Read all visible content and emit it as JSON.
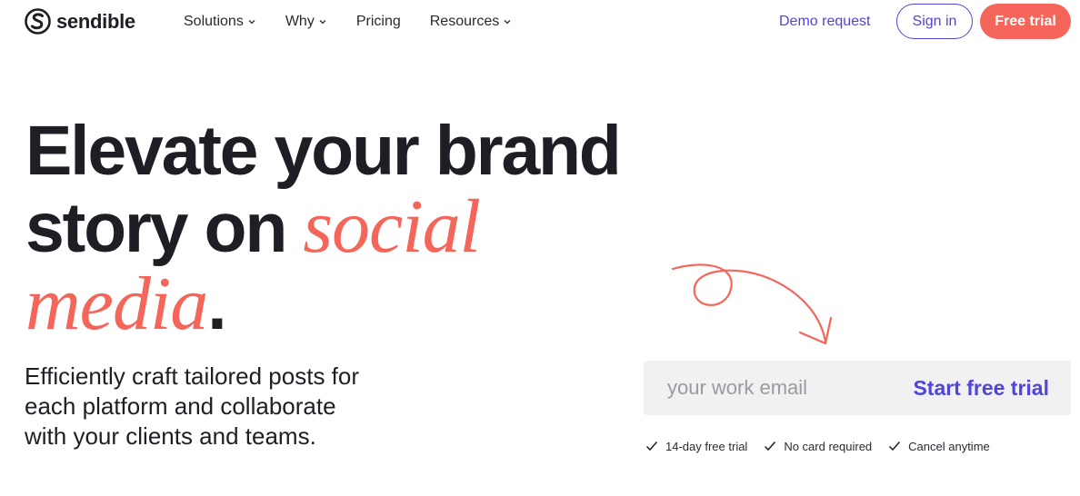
{
  "header": {
    "logo_text": "sendible",
    "logo_icon": "sendible-s-logo-icon",
    "nav": [
      {
        "label": "Solutions",
        "has_dropdown": true
      },
      {
        "label": "Why",
        "has_dropdown": true
      },
      {
        "label": "Pricing",
        "has_dropdown": false
      },
      {
        "label": "Resources",
        "has_dropdown": true
      }
    ],
    "demo_request": "Demo request",
    "sign_in": "Sign in",
    "free_trial": "Free trial"
  },
  "hero": {
    "headline_line1": "Elevate your brand",
    "headline_line2_plain": "story on ",
    "headline_line2_accent": "social",
    "headline_line3_accent": "media",
    "headline_line3_period": ".",
    "subtext": "Efficiently craft tailored posts for each platform and collaborate with your clients and teams.",
    "email_placeholder": "your work email",
    "cta": "Start free trial",
    "perks": [
      "14-day free trial",
      "No card required",
      "Cancel anytime"
    ]
  },
  "colors": {
    "brand_purple": "#4f46d8",
    "coral": "#f5655a",
    "text_dark": "#1f1e24",
    "input_bg": "#f1f1f1"
  }
}
